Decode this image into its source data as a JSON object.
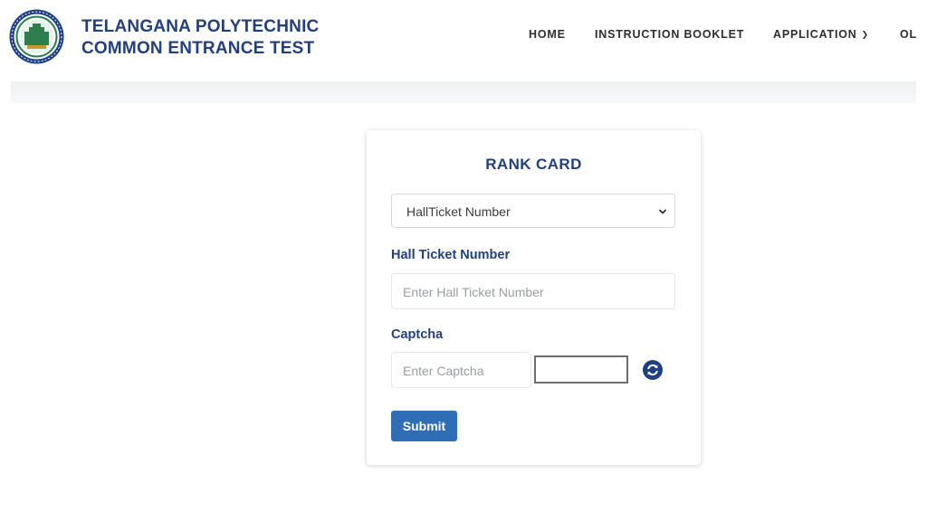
{
  "site": {
    "title_line1": "TELANGANA POLYTECHNIC",
    "title_line2": "COMMON ENTRANCE TEST",
    "logo_icon": "state-emblem-logo-icon"
  },
  "nav": {
    "items": [
      {
        "label": "HOME"
      },
      {
        "label": "INSTRUCTION BOOKLET"
      },
      {
        "label": "APPLICATION",
        "has_dropdown": true
      },
      {
        "label": "OL"
      }
    ]
  },
  "rank_card": {
    "title": "RANK CARD",
    "search_type": {
      "selected": "HallTicket Number",
      "icon": "chevron-down-icon"
    },
    "hall_ticket": {
      "label": "Hall Ticket Number",
      "placeholder": "Enter Hall Ticket Number",
      "value": ""
    },
    "captcha": {
      "label": "Captcha",
      "placeholder": "Enter Captcha",
      "value": "",
      "refresh_icon": "refresh-icon"
    },
    "submit_label": "Submit"
  },
  "colors": {
    "brand": "#23407e",
    "button": "#2f6eb5",
    "nav_text": "#2e2e2e"
  }
}
